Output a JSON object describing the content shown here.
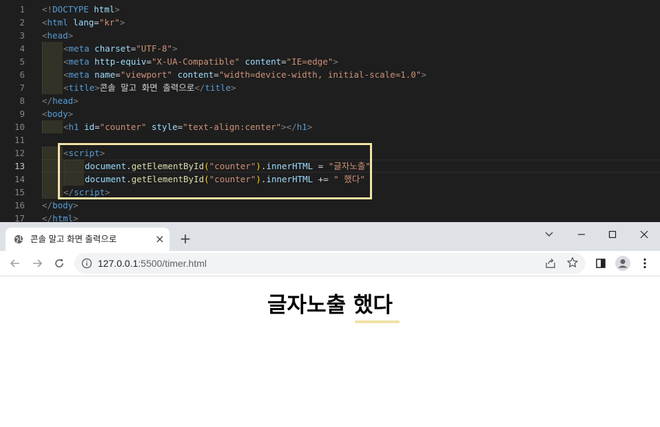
{
  "editor": {
    "line_numbers": [
      "1",
      "2",
      "3",
      "4",
      "5",
      "6",
      "7",
      "8",
      "9",
      "10",
      "11",
      "12",
      "13",
      "14",
      "15",
      "16",
      "17"
    ],
    "current_line": 13,
    "lines": [
      [
        [
          "br",
          "<!"
        ],
        [
          "tag",
          "DOCTYPE"
        ],
        [
          "txt",
          " "
        ],
        [
          "attr",
          "html"
        ],
        [
          "br",
          ">"
        ]
      ],
      [
        [
          "br",
          "<"
        ],
        [
          "tag",
          "html"
        ],
        [
          "txt",
          " "
        ],
        [
          "attr",
          "lang"
        ],
        [
          "txt",
          "="
        ],
        [
          "str",
          "\"kr\""
        ],
        [
          "br",
          ">"
        ]
      ],
      [
        [
          "br",
          "<"
        ],
        [
          "tag",
          "head"
        ],
        [
          "br",
          ">"
        ]
      ],
      [
        [
          "br",
          "<"
        ],
        [
          "tag",
          "meta"
        ],
        [
          "txt",
          " "
        ],
        [
          "attr",
          "charset"
        ],
        [
          "txt",
          "="
        ],
        [
          "str",
          "\"UTF-8\""
        ],
        [
          "br",
          ">"
        ]
      ],
      [
        [
          "br",
          "<"
        ],
        [
          "tag",
          "meta"
        ],
        [
          "txt",
          " "
        ],
        [
          "attr",
          "http-equiv"
        ],
        [
          "txt",
          "="
        ],
        [
          "str",
          "\"X-UA-Compatible\""
        ],
        [
          "txt",
          " "
        ],
        [
          "attr",
          "content"
        ],
        [
          "txt",
          "="
        ],
        [
          "str",
          "\"IE=edge\""
        ],
        [
          "br",
          ">"
        ]
      ],
      [
        [
          "br",
          "<"
        ],
        [
          "tag",
          "meta"
        ],
        [
          "txt",
          " "
        ],
        [
          "attr",
          "name"
        ],
        [
          "txt",
          "="
        ],
        [
          "str",
          "\"viewport\""
        ],
        [
          "txt",
          " "
        ],
        [
          "attr",
          "content"
        ],
        [
          "txt",
          "="
        ],
        [
          "str",
          "\"width=device-width, initial-scale=1.0\""
        ],
        [
          "br",
          ">"
        ]
      ],
      [
        [
          "br",
          "<"
        ],
        [
          "tag",
          "title"
        ],
        [
          "br",
          ">"
        ],
        [
          "txt",
          "콘솔 말고 화면 출력으로"
        ],
        [
          "br",
          "</"
        ],
        [
          "tag",
          "title"
        ],
        [
          "br",
          ">"
        ]
      ],
      [
        [
          "br",
          "</"
        ],
        [
          "tag",
          "head"
        ],
        [
          "br",
          ">"
        ]
      ],
      [
        [
          "br",
          "<"
        ],
        [
          "tag",
          "body"
        ],
        [
          "br",
          ">"
        ]
      ],
      [
        [
          "br",
          "<"
        ],
        [
          "tag",
          "h1"
        ],
        [
          "txt",
          " "
        ],
        [
          "attr",
          "id"
        ],
        [
          "txt",
          "="
        ],
        [
          "str",
          "\"counter\""
        ],
        [
          "txt",
          " "
        ],
        [
          "attr",
          "style"
        ],
        [
          "txt",
          "="
        ],
        [
          "str",
          "\"text-align:center\""
        ],
        [
          "br",
          "></"
        ],
        [
          "tag",
          "h1"
        ],
        [
          "br",
          ">"
        ]
      ],
      [],
      [
        [
          "br",
          "<"
        ],
        [
          "tag",
          "script"
        ],
        [
          "br",
          ">"
        ]
      ],
      [
        [
          "prop",
          "document"
        ],
        [
          "txt",
          "."
        ],
        [
          "fn",
          "getElementById"
        ],
        [
          "paren",
          "("
        ],
        [
          "str",
          "\"counter\""
        ],
        [
          "paren",
          ")"
        ],
        [
          "txt",
          "."
        ],
        [
          "prop",
          "innerHTML"
        ],
        [
          "txt",
          " = "
        ],
        [
          "str",
          "\"글자노출\""
        ]
      ],
      [
        [
          "prop",
          "document"
        ],
        [
          "txt",
          "."
        ],
        [
          "fn",
          "getElementById"
        ],
        [
          "paren",
          "("
        ],
        [
          "str",
          "\"counter\""
        ],
        [
          "paren",
          ")"
        ],
        [
          "txt",
          "."
        ],
        [
          "prop",
          "innerHTML"
        ],
        [
          "txt",
          " += "
        ],
        [
          "str",
          "\" 했다\""
        ]
      ],
      [
        [
          "br",
          "</"
        ],
        [
          "tag",
          "script"
        ],
        [
          "br",
          ">"
        ]
      ],
      [
        [
          "br",
          "</"
        ],
        [
          "tag",
          "body"
        ],
        [
          "br",
          ">"
        ]
      ],
      [
        [
          "br",
          "</"
        ],
        [
          "tag",
          "html"
        ],
        [
          "br",
          ">"
        ]
      ]
    ],
    "indents": [
      0,
      0,
      0,
      1,
      1,
      1,
      1,
      0,
      0,
      1,
      0,
      1,
      2,
      2,
      1,
      0,
      0
    ]
  },
  "browser": {
    "tab": {
      "title": "콘솔 말고 화면 출력으로",
      "favicon": "globe-icon",
      "close": "×"
    },
    "new_tab": "+",
    "address": {
      "host": "127.0.0.1",
      "path": ":5500/timer.html"
    },
    "page": {
      "heading": "글자노출 했다"
    }
  },
  "colors": {
    "editor_bg": "#1e1e1e",
    "tag": "#569cd6",
    "attr": "#9cdcfe",
    "string": "#ce9178",
    "highlight_box": "#f2e3a7",
    "tabstrip": "#dee1e6"
  }
}
